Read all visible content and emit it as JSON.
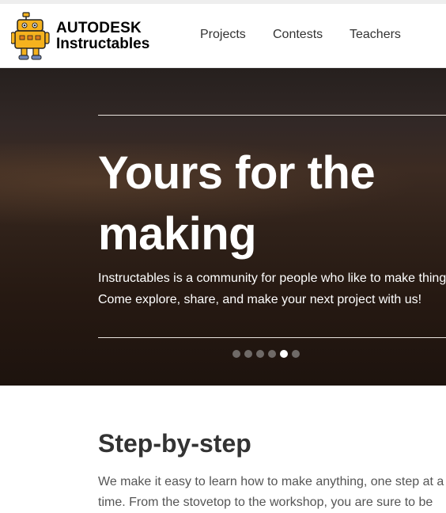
{
  "header": {
    "brand_top": "AUTODESK",
    "brand_bottom": "Instructables",
    "logo_icon": "robot-mascot-icon",
    "nav": [
      {
        "label": "Projects"
      },
      {
        "label": "Contests"
      },
      {
        "label": "Teachers"
      }
    ]
  },
  "hero": {
    "title_line1": "Yours for the",
    "title_line2": "making",
    "sub_line1": "Instructables is a community for people who like to make things.",
    "sub_line2": "Come explore, share, and make your next project with us!",
    "slide_count": 6,
    "active_slide": 5
  },
  "section": {
    "title": "Step-by-step",
    "text_line1": "We make it easy to learn how to make anything, one step at a",
    "text_line2": "time. From the stovetop to the workshop, you are sure to be"
  },
  "colors": {
    "mascot_yellow": "#f5b21e",
    "hero_text": "#ffffff",
    "nav_text": "#333333"
  }
}
